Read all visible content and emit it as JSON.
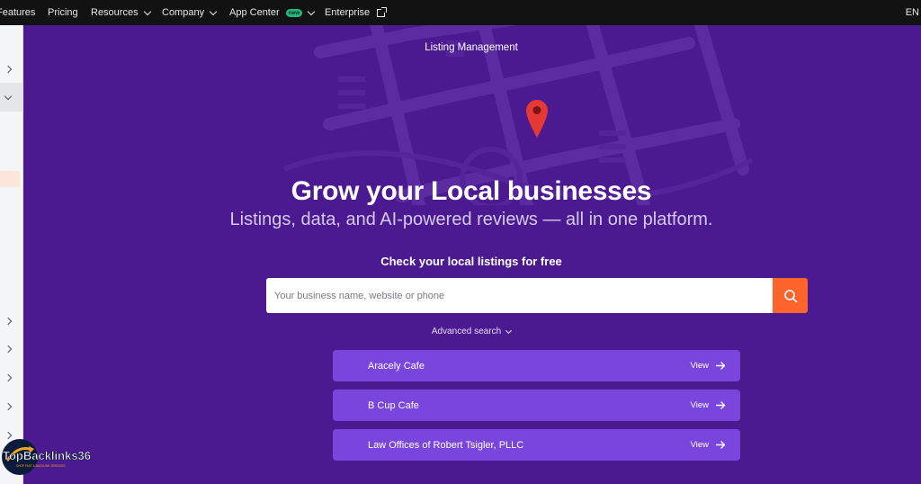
{
  "nav": {
    "items": [
      {
        "label": "Features",
        "has_dropdown": false
      },
      {
        "label": "Pricing",
        "has_dropdown": false
      },
      {
        "label": "Resources",
        "has_dropdown": true
      },
      {
        "label": "Company",
        "has_dropdown": true
      },
      {
        "label": "App Center",
        "has_dropdown": true,
        "badge": "new"
      },
      {
        "label": "Enterprise",
        "has_dropdown": false,
        "external": true
      }
    ],
    "language": "EN"
  },
  "hero": {
    "eyebrow": "Listing Management",
    "headline": "Grow your Local businesses",
    "subhead": "Listings, data, and AI-powered reviews — all in one platform.",
    "cta_label": "Check your local listings for free",
    "search": {
      "placeholder": "Your business name, website or phone",
      "value": ""
    },
    "advanced_search": "Advanced search",
    "results": [
      {
        "name": "Aracely Cafe",
        "action": "View"
      },
      {
        "name": "B Cup Cafe",
        "action": "View"
      },
      {
        "name": "Law Offices of Robert Tsigler, PLLC",
        "action": "View"
      }
    ]
  },
  "watermark": {
    "brand": "TopBacklinks360",
    "tagline": "SHOP FAST & BACKLINK SERVICES"
  },
  "colors": {
    "hero_bg": "#4b1990",
    "search_button": "#ff642d",
    "result_row": "#7a45dd",
    "pin": "#e53935",
    "new_badge": "#1fb87d"
  }
}
